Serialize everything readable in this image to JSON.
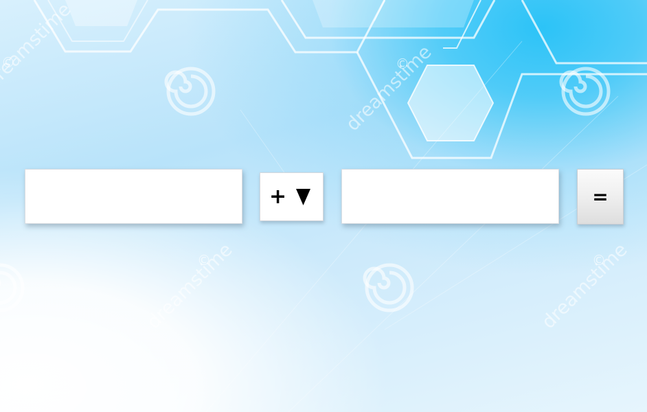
{
  "calculator": {
    "operand_a": {
      "value": "",
      "placeholder": ""
    },
    "operator": {
      "selected": "+",
      "icon": "caret-down-icon"
    },
    "operand_b": {
      "value": "",
      "placeholder": ""
    },
    "equals_label": "="
  },
  "background": {
    "watermark_text": "dreamstime",
    "watermark_symbol": "©",
    "colors": {
      "accent_blue": "#2cc3f7",
      "light_blue": "#b8e3fa",
      "white": "#ffffff"
    }
  }
}
